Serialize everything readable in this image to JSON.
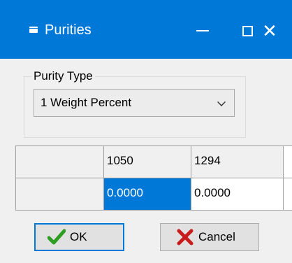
{
  "window": {
    "title": "Purities",
    "controls": [
      "minimize",
      "maximize",
      "close"
    ]
  },
  "purity_type": {
    "group_label": "Purity Type",
    "selected_value": "1 Weight Percent"
  },
  "grid": {
    "columns": [
      "1050",
      "1294"
    ],
    "rows": [
      {
        "values": [
          "0.0000",
          "0.0000"
        ]
      }
    ]
  },
  "buttons": {
    "ok_label": "OK",
    "cancel_label": "Cancel"
  },
  "colors": {
    "titlebar": "#0078d7",
    "selection": "#0078d7",
    "ok_check": "#2e9e22",
    "cancel_x": "#c81c1c"
  }
}
